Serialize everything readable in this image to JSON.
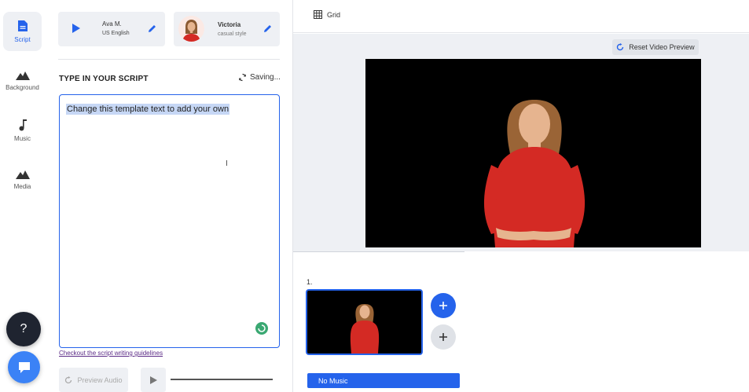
{
  "sidebar": {
    "items": [
      {
        "label": "Script",
        "icon": "document-icon"
      },
      {
        "label": "Background",
        "icon": "mountain-icon"
      },
      {
        "label": "Music",
        "icon": "music-note-icon"
      },
      {
        "label": "Media",
        "icon": "mountain-icon"
      }
    ],
    "help_label": "?"
  },
  "voice": {
    "name": "Ava M.",
    "language": "US English"
  },
  "avatar": {
    "name": "Victoria",
    "style": "casual style"
  },
  "script": {
    "title": "TYPE IN YOUR SCRIPT",
    "status": "Saving...",
    "text": "Change this template text to add your own",
    "guidelines_link": "Checkout the script writing guidelines",
    "preview_audio_label": "Preview Audio"
  },
  "toolbar": {
    "grid_label": "Grid",
    "reset_label": "Reset Video Preview"
  },
  "scenes": {
    "items": [
      {
        "number": "1."
      }
    ]
  },
  "music": {
    "label": "No Music"
  },
  "colors": {
    "accent": "#2563eb",
    "panel_bg": "#eef0f4",
    "dress": "#d42a24"
  }
}
